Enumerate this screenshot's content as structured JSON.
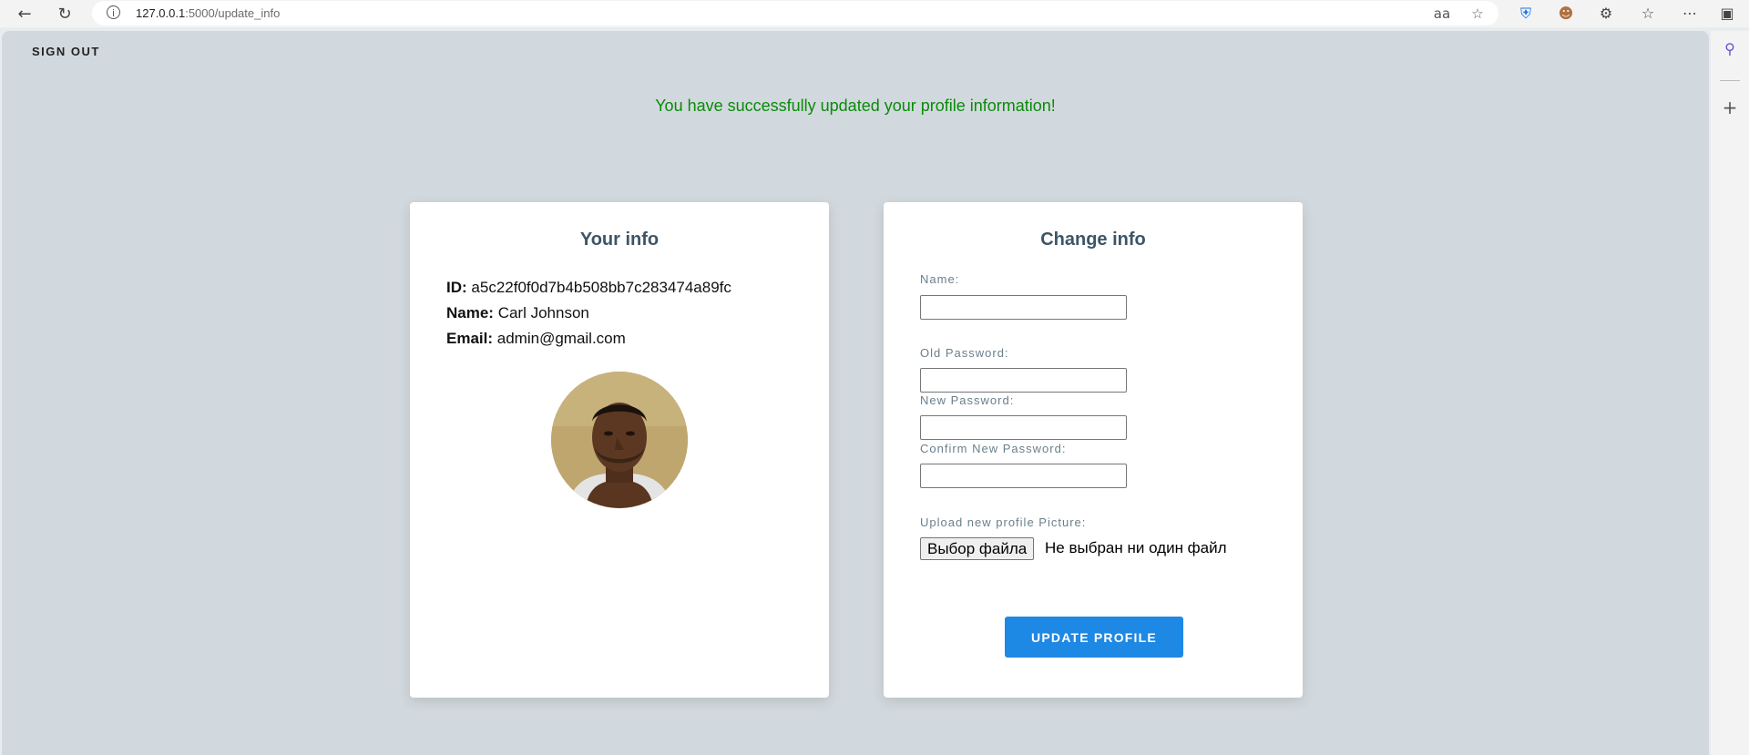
{
  "browser": {
    "url_host": "127.0.0.1",
    "url_path": ":5000/update_info"
  },
  "header": {
    "sign_out_label": "SIGN OUT"
  },
  "flash_message": "You have successfully updated your profile information!",
  "info_card": {
    "title": "Your info",
    "id_label": "ID:",
    "id_value": "a5c22f0f0d7b4b508bb7c283474a89fc",
    "name_label": "Name:",
    "name_value": "Carl Johnson",
    "email_label": "Email:",
    "email_value": "admin@gmail.com"
  },
  "change_card": {
    "title": "Change info",
    "name_label": "Name:",
    "old_password_label": "Old Password:",
    "new_password_label": "New Password:",
    "confirm_password_label": "Confirm New Password:",
    "upload_label": "Upload new profile Picture:",
    "file_button_label": "Выбор файла",
    "file_status": "Не выбран ни один файл",
    "submit_label": "UPDATE PROFILE"
  },
  "colors": {
    "success": "#0a8a0a",
    "accent": "#1e88e5",
    "background": "#d2d9de"
  }
}
